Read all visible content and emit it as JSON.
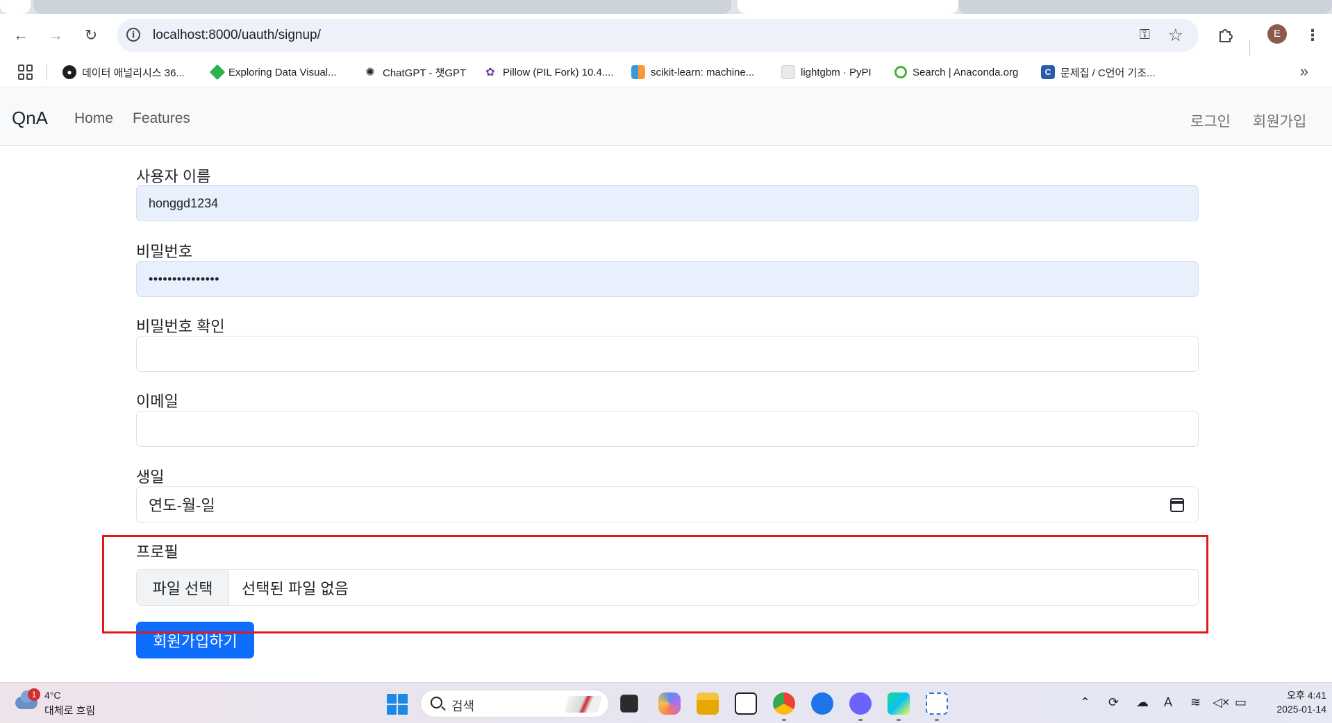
{
  "browser": {
    "url": "localhost:8000/uauth/signup/",
    "profile_initial": "E",
    "bookmarks": [
      {
        "label": "데이터 애널리시스 36...",
        "icon": "github-icon"
      },
      {
        "label": "Exploring Data Visual...",
        "icon": "diamond-icon"
      },
      {
        "label": "ChatGPT - 챗GPT",
        "icon": "openai-icon"
      },
      {
        "label": "Pillow (PIL Fork) 10.4....",
        "icon": "python-icon"
      },
      {
        "label": "scikit-learn: machine...",
        "icon": "chart-icon"
      },
      {
        "label": "lightgbm · PyPI",
        "icon": "cube-icon"
      },
      {
        "label": "Search | Anaconda.org",
        "icon": "anaconda-icon"
      },
      {
        "label": "문제집 / C언어 기조...",
        "icon": "c-icon"
      }
    ]
  },
  "navbar": {
    "brand": "QnA",
    "links": [
      "Home",
      "Features"
    ],
    "login": "로그인",
    "signup": "회원가입"
  },
  "form": {
    "username_label": "사용자 이름",
    "username_value": "honggd1234",
    "password_label": "비밀번호",
    "password_value": "•••••••••••••••",
    "password_confirm_label": "비밀번호 확인",
    "password_confirm_value": "",
    "email_label": "이메일",
    "email_value": "",
    "birthday_label": "생일",
    "birthday_placeholder": "연도-월-일",
    "profile_label": "프로필",
    "file_button": "파일 선택",
    "file_status": "선택된 파일 없음",
    "submit": "회원가입하기"
  },
  "taskbar": {
    "weather_badge": "1",
    "temperature": "4°C",
    "weather_desc": "대체로 흐림",
    "search_text": "검색",
    "time": "오후 4:41",
    "date": "2025-01-14"
  },
  "colors": {
    "primary": "#0d6efd",
    "highlight": "#e0191c",
    "autofill": "#e8f0fe"
  }
}
